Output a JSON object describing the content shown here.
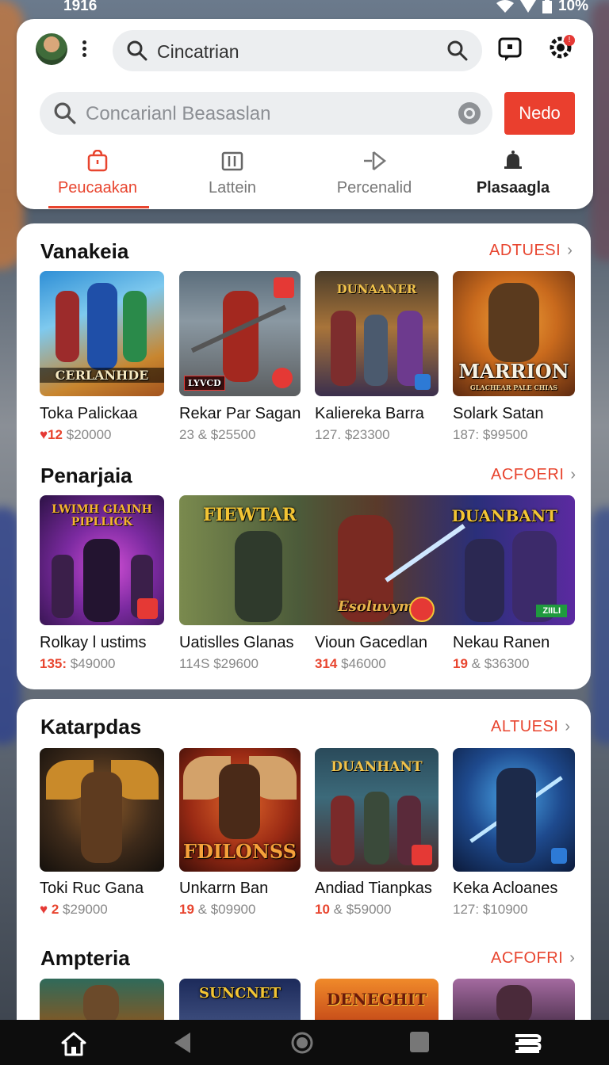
{
  "status_bar": {
    "time": "1916",
    "battery": "10%"
  },
  "header": {
    "search_top": {
      "value": "Cincatrian"
    },
    "search_main": {
      "placeholder": "Concarianl Beasaslan"
    },
    "action_button": "Nedo",
    "notification_count": "!",
    "tabs": [
      {
        "label": "Peucaakan",
        "icon": "bag-icon",
        "active": true
      },
      {
        "label": "Lattein",
        "icon": "grid-icon",
        "active": false
      },
      {
        "label": "Percenalid",
        "icon": "send-icon",
        "active": false
      },
      {
        "label": "Plasaagla",
        "icon": "bell-icon",
        "active": false
      }
    ]
  },
  "sections": [
    {
      "title": "Vanakeia",
      "more": "ADTUESI",
      "items": [
        {
          "title": "Toka Palickaa",
          "count": "12",
          "price": "$20000",
          "caption": "CERLANHDE",
          "icon": "heart-icon"
        },
        {
          "title": "Rekar Par Sagan",
          "count": "23",
          "price": "$25500",
          "caption": "LYVCD"
        },
        {
          "title": "Kaliereka Barra",
          "count": "127.",
          "price": "$23300",
          "caption": "DUNAANER"
        },
        {
          "title": "Solark Satan",
          "count": "187:",
          "price": "$99500",
          "caption": "MARRION",
          "subcaption": "GLACHEAR PALE CHIAS"
        }
      ]
    },
    {
      "title": "Penarjaia",
      "more": "ACFOERI",
      "items": [
        {
          "title": "Rolkay l ustims",
          "count": "135:",
          "price": "$49000",
          "caption": "LWIMH GIAINH PIPLLICK"
        },
        {
          "title": "Uatislles Glanas",
          "count": "114S",
          "price": "$29600",
          "caption": "FIEWTAR"
        },
        {
          "title": "Vioun Gacedlan",
          "count": "314",
          "price": "$46000",
          "caption": "Esoluvym"
        },
        {
          "title": "Nekau Ranen",
          "count": "19",
          "price": "$36300",
          "caption": "DUANBANT",
          "chip": "ZIILI"
        }
      ]
    },
    {
      "title": "Katarpdas",
      "more": "ALTUESI",
      "items": [
        {
          "title": "Toki Ruc Gana",
          "count": "2",
          "price": "$29000",
          "icon": "heart-icon"
        },
        {
          "title": "Unkarrn Ban",
          "count": "19",
          "price": "$09900",
          "caption": "FDILONSS"
        },
        {
          "title": "Andiad Tianpkas",
          "count": "10",
          "price": "$59000",
          "caption": "DUANHANT"
        },
        {
          "title": "Keka Acloanes",
          "count": "127:",
          "price": "$10900"
        }
      ]
    },
    {
      "title": "Ampteria",
      "more": "ACFOFRI",
      "items": [
        {
          "caption": ""
        },
        {
          "caption": "SUNCNET"
        },
        {
          "caption": "DENEGHIT"
        },
        {
          "caption": ""
        }
      ]
    }
  ],
  "navbar": {
    "items": [
      "home-icon",
      "back-icon",
      "circle-home-icon",
      "recents-icon",
      "menu-icon"
    ]
  },
  "colors": {
    "accent": "#e8452f",
    "card": "#ffffff",
    "nav": "#0d0d0d"
  }
}
